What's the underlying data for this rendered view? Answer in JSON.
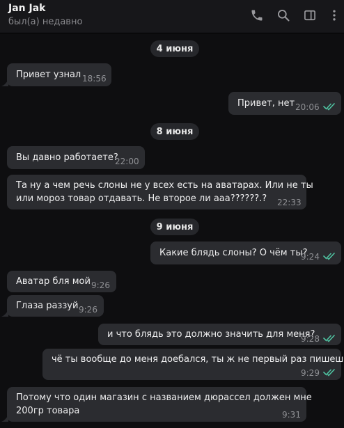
{
  "header": {
    "contact_name": "Jan Jak",
    "status": "был(а) недавно",
    "icons": [
      "phone-icon",
      "search-icon",
      "sidebar-icon",
      "more-icon"
    ]
  },
  "colors": {
    "background": "#0e0e10",
    "header": "#17171a",
    "bubble": "#2b2c30",
    "read_check": "#4fc3a1",
    "time": "#8f9094"
  },
  "dates": [
    "4 июня",
    "8 июня",
    "9 июня"
  ],
  "messages": [
    {
      "dir": "in",
      "text": "Привет узнал",
      "time": "18:56"
    },
    {
      "dir": "out",
      "text": "Привет, нет",
      "time": "20:06",
      "read": true
    },
    {
      "dir": "in",
      "text": "Вы давно работаете?",
      "time": "22:00"
    },
    {
      "dir": "in",
      "line1": "Та ну а чем речь слоны не у всех есть на аватарах. Или не ты",
      "line2": "или мороз товар отдавать. Не второе ли ааа??????.?",
      "time": "22:33"
    },
    {
      "dir": "out",
      "text": "Какие блядь слоны? О чём ты?",
      "time": "9:24",
      "read": true
    },
    {
      "dir": "in",
      "text": "Аватар бля мой",
      "time": "9:26"
    },
    {
      "dir": "in",
      "text": "Глаза раззуй",
      "time": "9:26"
    },
    {
      "dir": "out",
      "text": "и что блядь это должно значить для меня?",
      "time": "9:28",
      "read": true
    },
    {
      "dir": "out",
      "text": "чё ты вообще до меня доебался, ты ж не первый раз пишешь",
      "time": "9:29",
      "read": true
    },
    {
      "dir": "in",
      "line1": "Потому что один магазин с названием дюрассел должен мне",
      "line2": "200гр товара",
      "time": "9:31"
    }
  ]
}
